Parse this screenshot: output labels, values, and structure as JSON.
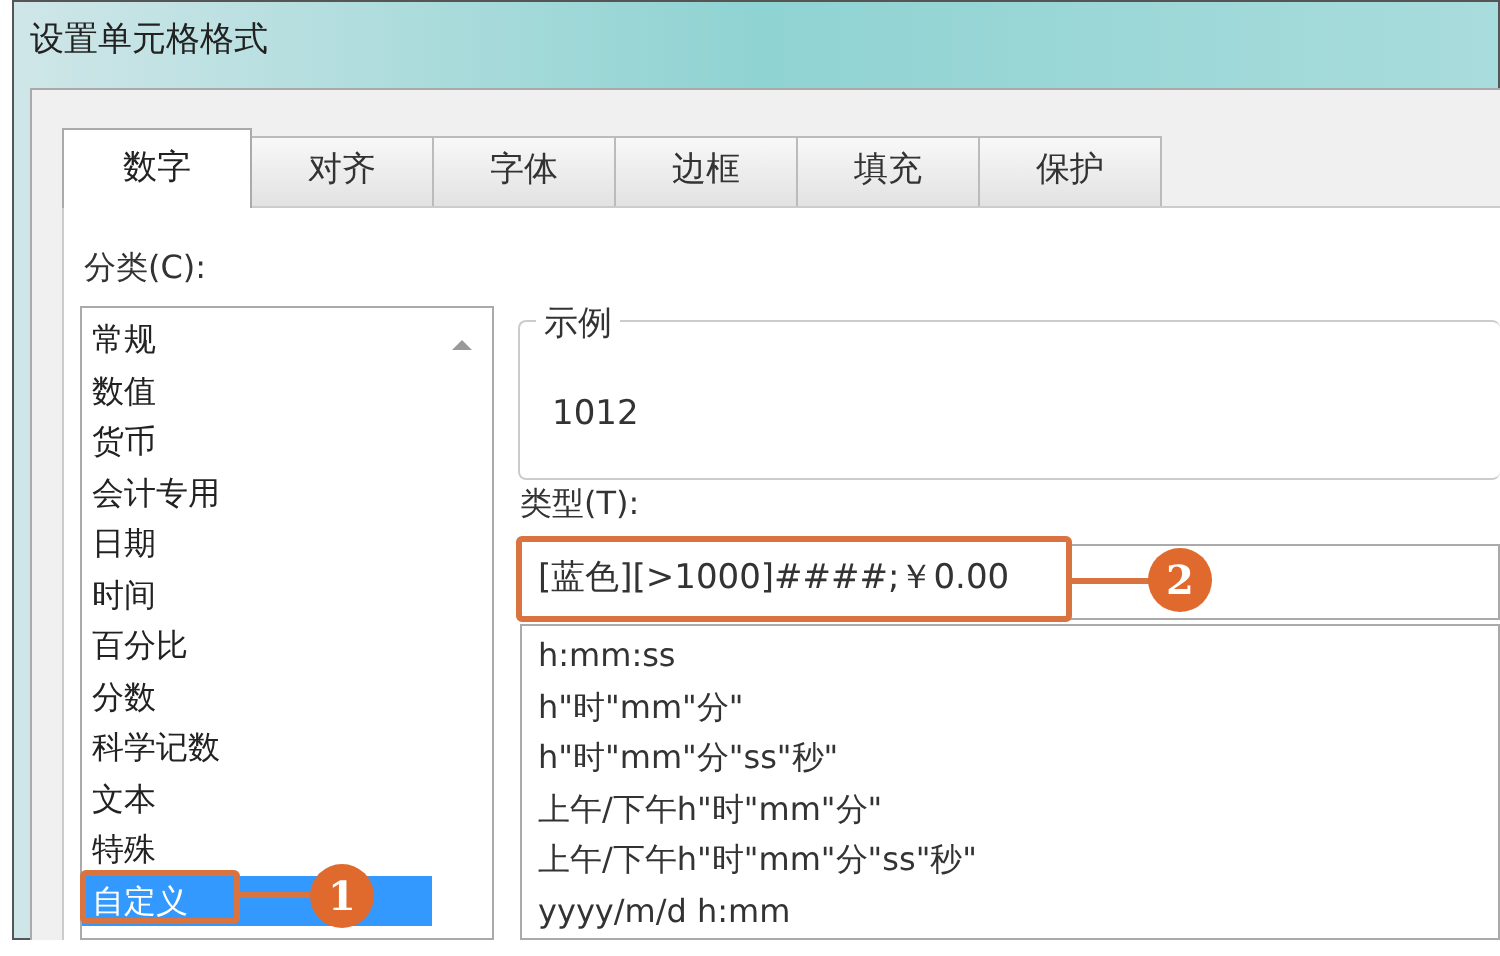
{
  "window": {
    "title": "设置单元格格式"
  },
  "tabs": [
    {
      "label": "数字",
      "selected": true
    },
    {
      "label": "对齐",
      "selected": false
    },
    {
      "label": "字体",
      "selected": false
    },
    {
      "label": "边框",
      "selected": false
    },
    {
      "label": "填充",
      "selected": false
    },
    {
      "label": "保护",
      "selected": false
    }
  ],
  "category": {
    "label": "分类(C):",
    "items": [
      {
        "label": "常规",
        "selected": false
      },
      {
        "label": "数值",
        "selected": false
      },
      {
        "label": "货币",
        "selected": false
      },
      {
        "label": "会计专用",
        "selected": false
      },
      {
        "label": "日期",
        "selected": false
      },
      {
        "label": "时间",
        "selected": false
      },
      {
        "label": "百分比",
        "selected": false
      },
      {
        "label": "分数",
        "selected": false
      },
      {
        "label": "科学记数",
        "selected": false
      },
      {
        "label": "文本",
        "selected": false
      },
      {
        "label": "特殊",
        "selected": false
      },
      {
        "label": "自定义",
        "selected": true
      }
    ]
  },
  "sample": {
    "label": "示例",
    "value": "1012"
  },
  "type": {
    "label": "类型(T):",
    "value": "[蓝色][>1000]####;￥0.00",
    "items": [
      "h:mm:ss",
      "h\"时\"mm\"分\"",
      "h\"时\"mm\"分\"ss\"秒\"",
      "上午/下午h\"时\"mm\"分\"",
      "上午/下午h\"时\"mm\"分\"ss\"秒\"",
      "yyyy/m/d h:mm"
    ]
  },
  "callouts": [
    {
      "number": "1"
    },
    {
      "number": "2"
    }
  ]
}
